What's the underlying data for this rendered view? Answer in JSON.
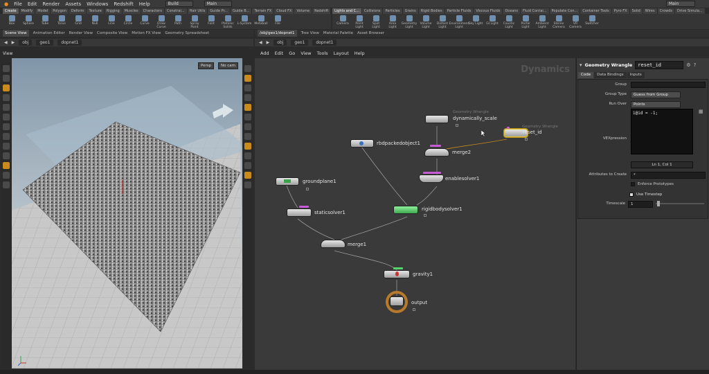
{
  "menubar": {
    "items": [
      "File",
      "Edit",
      "Render",
      "Assets",
      "Windows",
      "Redshift",
      "Help"
    ],
    "build_label": "Build",
    "main_label": "Main",
    "right_main_label": "Main"
  },
  "shelf_tabs_left": [
    "Create",
    "Modify",
    "Model",
    "Polygon",
    "Deform",
    "Texture",
    "Rigging",
    "Muscles",
    "Characters",
    "Constrai...",
    "Hair Utils",
    "Guide Pr...",
    "Guide B...",
    "Terrain FX",
    "Cloud FX",
    "Volume",
    "Redshift"
  ],
  "shelf_tabs_right": [
    "Lights and C...",
    "Collisions",
    "Particles",
    "Grains",
    "Rigid Bodies",
    "Particle Fluids",
    "Viscous Fluids",
    "Oceans",
    "Fluid Contai...",
    "Populate Con...",
    "Container Tools",
    "Pyro FX",
    "Solid",
    "Wires",
    "Crowds",
    "Drive Simula..."
  ],
  "shelf_tools_left": [
    "Box",
    "Sphere",
    "Tube",
    "Torus",
    "Grid",
    "Null",
    "Line",
    "Circle",
    "Curve",
    "Draw Curve",
    "Path",
    "Spray Paint",
    "Font",
    "Platonic Solids",
    "L-System",
    "Metaball",
    "File"
  ],
  "shelf_tools_right": [
    "Camera",
    "Point Light",
    "Spot Light",
    "Area Light",
    "Geometry Light",
    "Volume Light",
    "Distant Light",
    "Environment Light",
    "Sky Light",
    "GI Light",
    "Caustic Light",
    "Portal Light",
    "Ambient Light",
    "Stereo Camera",
    "VR Camera",
    "Switcher"
  ],
  "pane_tabs_left": [
    "Scene View",
    "Animation Editor",
    "Render View",
    "Composite View",
    "Motion FX View",
    "Geometry Spreadsheet"
  ],
  "pane_tabs_right": [
    "/obj/geo1/dopnet1",
    "Tree View",
    "Material Palette",
    "Asset Browser"
  ],
  "path_left": [
    "obj",
    "geo1",
    "dopnet1"
  ],
  "path_right": [
    "obj",
    "geo1",
    "dopnet1"
  ],
  "viewport": {
    "title": "View",
    "camera_btn": "Persp",
    "cam_btn": "No cam"
  },
  "network": {
    "menu": [
      "Add",
      "Edit",
      "Go",
      "View",
      "Tools",
      "Layout",
      "Help"
    ],
    "title": "Dynamics",
    "nodes": {
      "dynamically_scale": {
        "label": "dynamically_scale",
        "sub": "Geometry Wrangle"
      },
      "reset_id": {
        "label": "reset_id",
        "sub": "Geometry Wrangle"
      },
      "merge2": {
        "label": "merge2"
      },
      "rbdpackedobject1": {
        "label": "rbdpackedobject1"
      },
      "enablesolver1": {
        "label": "enablesolver1"
      },
      "groundplane1": {
        "label": "groundplane1"
      },
      "staticsolver1": {
        "label": "staticsolver1"
      },
      "rigidbodysolver1": {
        "label": "rigidbodysolver1"
      },
      "merge1": {
        "label": "merge1"
      },
      "gravity1": {
        "label": "gravity1"
      },
      "output": {
        "label": "output"
      }
    }
  },
  "params": {
    "node_type": "Geometry Wrangle",
    "node_name": "reset_id",
    "tabs": [
      "Code",
      "Data Bindings",
      "Inputs"
    ],
    "group_label": "Group",
    "group_value": "",
    "group_type_label": "Group Type",
    "group_type_value": "Guess from Group",
    "run_over_label": "Run Over",
    "run_over_value": "Points",
    "vex_label": "VEXpression",
    "vex_code": "i@id = -1;",
    "cursor_pos": "Ln 1, Col 1",
    "attr_label": "Attributes to Create",
    "attr_value": "*",
    "enforce_label": "Enforce Prototypes",
    "use_timestep_label": "Use Timestep",
    "timescale_label": "Timescale",
    "timescale_value": "1"
  },
  "colors": {
    "accent_orange": "#c98c1c",
    "selected_node": "#e3c12a",
    "flag_purple": "#c75bd6",
    "flag_green": "#55d66a",
    "wire": "#999999"
  }
}
